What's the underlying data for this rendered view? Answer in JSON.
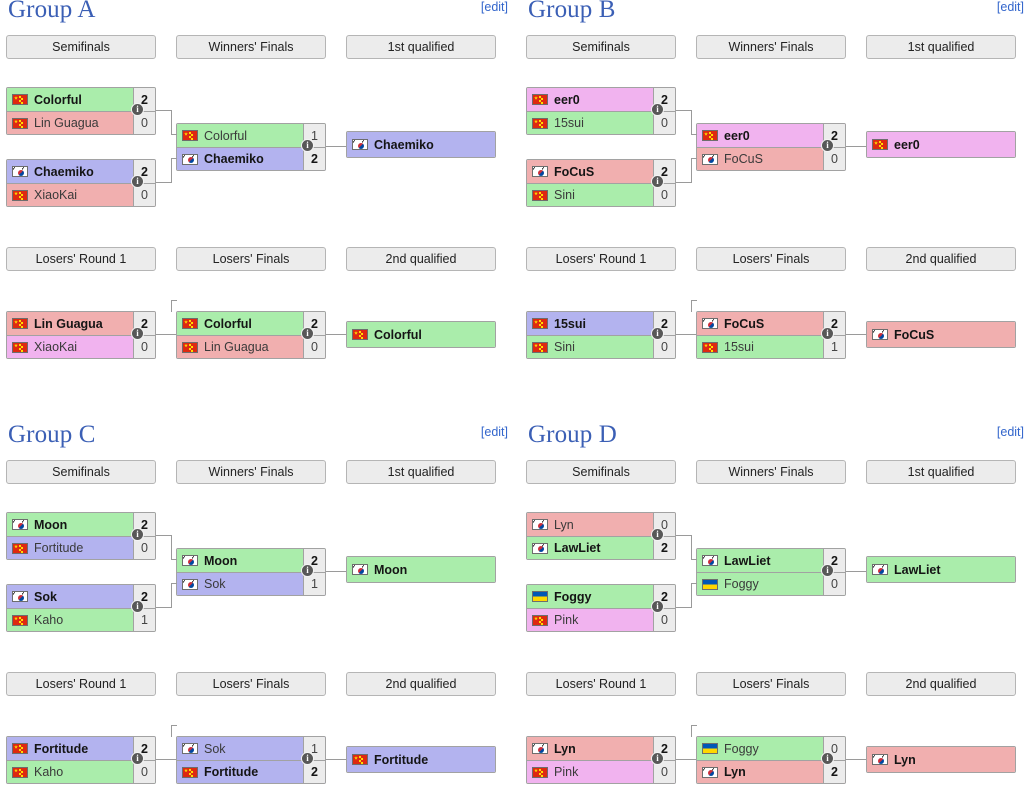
{
  "edit_label": "[edit]",
  "info_glyph": "i",
  "rounds": {
    "upper": [
      "Semifinals",
      "Winners' Finals",
      "1st qualified"
    ],
    "lower": [
      "Losers' Round 1",
      "Losers' Finals",
      "2nd qualified"
    ]
  },
  "colors": {
    "green": "#aaedab",
    "red": "#f1afaf",
    "purple": "#b3b3ef",
    "pink": "#f1b3ef",
    "title": "#3b5fb5",
    "link": "#3366cc",
    "header_bg": "#ececec"
  },
  "groups": [
    {
      "id": "a",
      "title": "Group A",
      "sf1": {
        "top": {
          "name": "Colorful",
          "flag": "cn",
          "score": "2",
          "color": "green",
          "winner": true
        },
        "bottom": {
          "name": "Lin Guagua",
          "flag": "cn",
          "score": "0",
          "color": "red",
          "winner": false
        }
      },
      "sf2": {
        "top": {
          "name": "Chaemiko",
          "flag": "kr",
          "score": "2",
          "color": "purple",
          "winner": true
        },
        "bottom": {
          "name": "XiaoKai",
          "flag": "cn",
          "score": "0",
          "color": "red",
          "winner": false
        }
      },
      "wf": {
        "top": {
          "name": "Colorful",
          "flag": "cn",
          "score": "1",
          "color": "green",
          "winner": false
        },
        "bottom": {
          "name": "Chaemiko",
          "flag": "kr",
          "score": "2",
          "color": "purple",
          "winner": true
        }
      },
      "first": {
        "name": "Chaemiko",
        "flag": "kr",
        "color": "purple"
      },
      "lr1": {
        "top": {
          "name": "Lin Guagua",
          "flag": "cn",
          "score": "2",
          "color": "red",
          "winner": true
        },
        "bottom": {
          "name": "XiaoKai",
          "flag": "cn",
          "score": "0",
          "color": "pink",
          "winner": false
        }
      },
      "lf": {
        "top": {
          "name": "Colorful",
          "flag": "cn",
          "score": "2",
          "color": "green",
          "winner": true
        },
        "bottom": {
          "name": "Lin Guagua",
          "flag": "cn",
          "score": "0",
          "color": "red",
          "winner": false
        }
      },
      "second": {
        "name": "Colorful",
        "flag": "cn",
        "color": "green"
      }
    },
    {
      "id": "b",
      "title": "Group B",
      "sf1": {
        "top": {
          "name": "eer0",
          "flag": "cn",
          "score": "2",
          "color": "pink",
          "winner": true
        },
        "bottom": {
          "name": "15sui",
          "flag": "cn",
          "score": "0",
          "color": "green",
          "winner": false
        }
      },
      "sf2": {
        "top": {
          "name": "FoCuS",
          "flag": "kr",
          "score": "2",
          "color": "red",
          "winner": true
        },
        "bottom": {
          "name": "Sini",
          "flag": "cn",
          "score": "0",
          "color": "green",
          "winner": false
        }
      },
      "wf": {
        "top": {
          "name": "eer0",
          "flag": "cn",
          "score": "2",
          "color": "pink",
          "winner": true
        },
        "bottom": {
          "name": "FoCuS",
          "flag": "kr",
          "score": "0",
          "color": "red",
          "winner": false
        }
      },
      "first": {
        "name": "eer0",
        "flag": "cn",
        "color": "pink"
      },
      "lr1": {
        "top": {
          "name": "15sui",
          "flag": "cn",
          "score": "2",
          "color": "purple",
          "winner": true
        },
        "bottom": {
          "name": "Sini",
          "flag": "cn",
          "score": "0",
          "color": "green",
          "winner": false
        }
      },
      "lf": {
        "top": {
          "name": "FoCuS",
          "flag": "kr",
          "score": "2",
          "color": "red",
          "winner": true
        },
        "bottom": {
          "name": "15sui",
          "flag": "cn",
          "score": "1",
          "color": "green",
          "winner": false
        }
      },
      "second": {
        "name": "FoCuS",
        "flag": "kr",
        "color": "red"
      }
    },
    {
      "id": "c",
      "title": "Group C",
      "sf1": {
        "top": {
          "name": "Moon",
          "flag": "kr",
          "score": "2",
          "color": "green",
          "winner": true
        },
        "bottom": {
          "name": "Fortitude",
          "flag": "cn",
          "score": "0",
          "color": "purple",
          "winner": false
        }
      },
      "sf2": {
        "top": {
          "name": "Sok",
          "flag": "kr",
          "score": "2",
          "color": "purple",
          "winner": true
        },
        "bottom": {
          "name": "Kaho",
          "flag": "cn",
          "score": "1",
          "color": "green",
          "winner": false
        }
      },
      "wf": {
        "top": {
          "name": "Moon",
          "flag": "kr",
          "score": "2",
          "color": "green",
          "winner": true
        },
        "bottom": {
          "name": "Sok",
          "flag": "kr",
          "score": "1",
          "color": "purple",
          "winner": false
        }
      },
      "first": {
        "name": "Moon",
        "flag": "kr",
        "color": "green"
      },
      "lr1": {
        "top": {
          "name": "Fortitude",
          "flag": "cn",
          "score": "2",
          "color": "purple",
          "winner": true
        },
        "bottom": {
          "name": "Kaho",
          "flag": "cn",
          "score": "0",
          "color": "green",
          "winner": false
        }
      },
      "lf": {
        "top": {
          "name": "Sok",
          "flag": "kr",
          "score": "1",
          "color": "purple",
          "winner": false
        },
        "bottom": {
          "name": "Fortitude",
          "flag": "cn",
          "score": "2",
          "color": "purple",
          "winner": true
        }
      },
      "second": {
        "name": "Fortitude",
        "flag": "cn",
        "color": "purple"
      }
    },
    {
      "id": "d",
      "title": "Group D",
      "sf1": {
        "top": {
          "name": "Lyn",
          "flag": "kr",
          "score": "0",
          "color": "red",
          "winner": false
        },
        "bottom": {
          "name": "LawLiet",
          "flag": "kr",
          "score": "2",
          "color": "green",
          "winner": true
        }
      },
      "sf2": {
        "top": {
          "name": "Foggy",
          "flag": "ua",
          "score": "2",
          "color": "green",
          "winner": true
        },
        "bottom": {
          "name": "Pink",
          "flag": "cn",
          "score": "0",
          "color": "pink",
          "winner": false
        }
      },
      "wf": {
        "top": {
          "name": "LawLiet",
          "flag": "kr",
          "score": "2",
          "color": "green",
          "winner": true
        },
        "bottom": {
          "name": "Foggy",
          "flag": "ua",
          "score": "0",
          "color": "green",
          "winner": false
        }
      },
      "first": {
        "name": "LawLiet",
        "flag": "kr",
        "color": "green"
      },
      "lr1": {
        "top": {
          "name": "Lyn",
          "flag": "kr",
          "score": "2",
          "color": "red",
          "winner": true
        },
        "bottom": {
          "name": "Pink",
          "flag": "cn",
          "score": "0",
          "color": "pink",
          "winner": false
        }
      },
      "lf": {
        "top": {
          "name": "Foggy",
          "flag": "ua",
          "score": "0",
          "color": "green",
          "winner": false
        },
        "bottom": {
          "name": "Lyn",
          "flag": "kr",
          "score": "2",
          "color": "red",
          "winner": true
        }
      },
      "second": {
        "name": "Lyn",
        "flag": "kr",
        "color": "red"
      }
    }
  ]
}
